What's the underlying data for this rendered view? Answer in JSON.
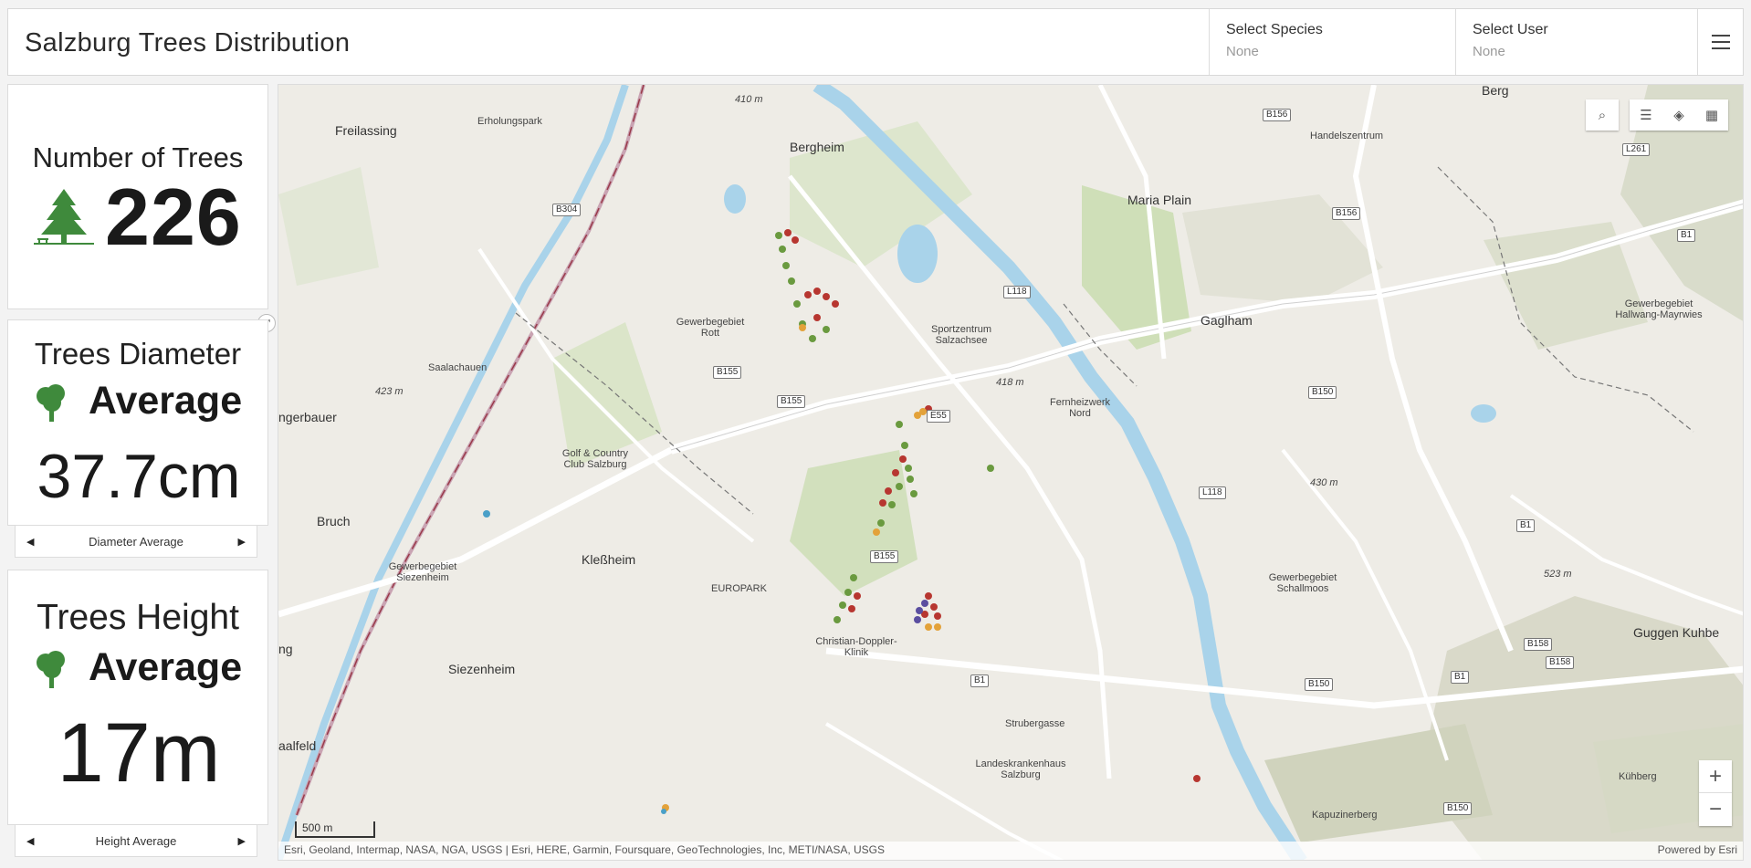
{
  "header": {
    "title": "Salzburg Trees Distribution",
    "species_label": "Select Species",
    "species_value": "None",
    "user_label": "Select User",
    "user_value": "None"
  },
  "trees_count": {
    "title": "Number of Trees",
    "value": "226"
  },
  "diameter": {
    "title": "Trees Diameter",
    "subtitle": "Average",
    "value": "37.7cm",
    "nav_label": "Diameter Average"
  },
  "height": {
    "title": "Trees Height",
    "subtitle": "Average",
    "value": "17m",
    "nav_label": "Height Average"
  },
  "map": {
    "scale_label": "500 m",
    "attribution": "Esri, Geoland, Intermap, NASA, NGA, USGS | Esri, HERE, Garmin, Foursquare, GeoTechnologies, Inc, METI/NASA, USGS",
    "powered_by": "Powered by Esri",
    "zoom_in": "+",
    "zoom_out": "−",
    "labels": {
      "freilassing": "Freilassing",
      "bergheim": "Bergheim",
      "maria_plain": "Maria Plain",
      "gaglham": "Gaglham",
      "klessheim": "Kleßheim",
      "siezenheim": "Siezenheim",
      "bruch": "Bruch",
      "berg": "Berg",
      "europark": "EUROPARK",
      "golf": "Golf & Country Club Salzburg",
      "gewerbe_rott": "Gewerbegebiet Rott",
      "sportzentrum": "Sportzentrum Salzachsee",
      "fernheizwerk": "Fernheizwerk Nord",
      "christian": "Christian-Doppler-Klinik",
      "landeskranken": "Landeskrankenhaus Salzburg",
      "kapuzinerberg": "Kapuzinerberg",
      "gewerbe_schallmoos": "Gewerbegebiet Schallmoos",
      "gewerbe_siezenheim": "Gewerbegebiet Siezenheim",
      "handelszentrum": "Handelszentrum",
      "erholungspark": "Erholungspark",
      "saalachauen": "Saalachauen",
      "hallwang": "Gewerbegebiet Hallwang-Mayrwies",
      "kuhberg": "Kühberg",
      "guggen": "Guggen Kuhbe",
      "saalfeld": "aalfeld",
      "ngerbauer": "ngerbauer",
      "ng": "ng",
      "elev_410": "410 m",
      "elev_418": "418 m",
      "elev_423": "423 m",
      "elev_430": "430 m",
      "elev_523": "523 m",
      "strubergasse": "Strubergasse"
    },
    "shields": [
      "B156",
      "B304",
      "B155",
      "B155",
      "E55",
      "L118",
      "B156",
      "B150",
      "L118",
      "B155",
      "B1",
      "B150",
      "B158",
      "B158",
      "B1",
      "B1",
      "B1",
      "L261",
      "B150"
    ]
  }
}
